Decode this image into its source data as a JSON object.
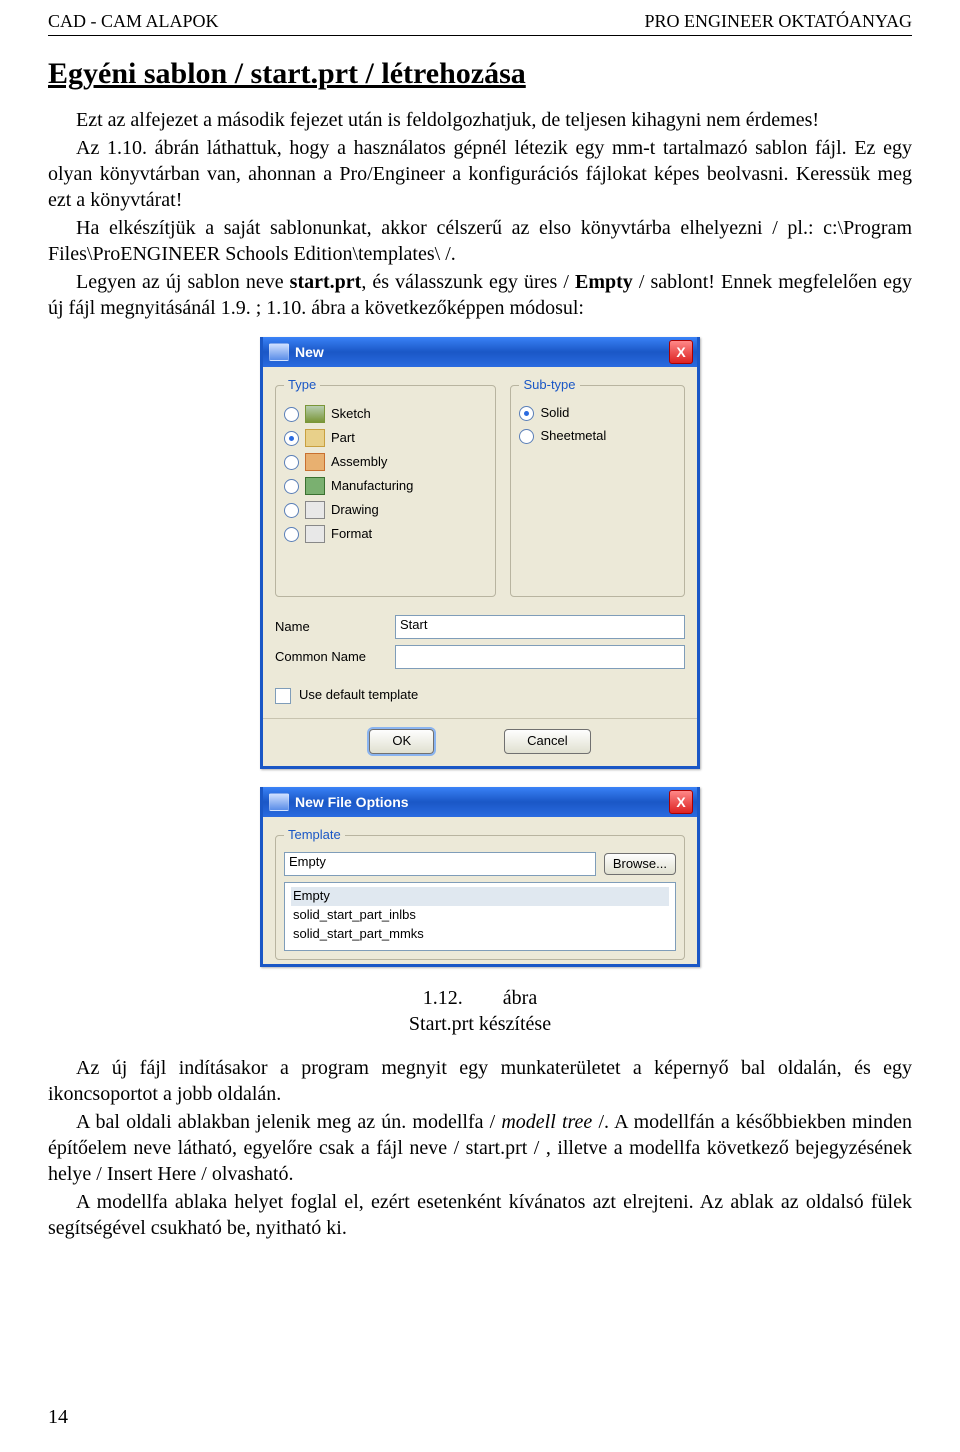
{
  "header": {
    "left": "CAD - CAM ALAPOK",
    "right": "PRO ENGINEER OKTATÓANYAG"
  },
  "section_title": "Egyéni sablon / start.prt / létrehozása",
  "paragraphs_top": [
    "Ezt az alfejezet a második fejezet után is feldolgozhatjuk, de teljesen kihagyni nem érdemes!",
    "Az 1.10. ábrán láthattuk, hogy a használatos gépnél létezik egy mm-t tartalmazó sablon fájl. Ez egy olyan könyvtárban van, ahonnan a Pro/Engineer a konfigurációs fájlokat képes beolvasni. Keressük meg ezt a könyvtárat!",
    "Ha elkészítjük a saját sablonunkat, akkor célszerű az elso könyvtárba elhelyezni / pl.: c:\\Program Files\\ProENGINEER Schools Edition\\templates\\  /.",
    "Legyen az új sablon neve start.prt, és válasszunk egy üres / Empty / sablont! Ennek megfelelően egy új fájl megnyitásánál 1.9. ; 1.10. ábra a következőképpen módosul:"
  ],
  "dlg_new": {
    "title": "New",
    "close_x": "X",
    "type_legend": "Type",
    "sub_legend": "Sub-type",
    "types": [
      {
        "label": "Sketch",
        "checked": false,
        "ic": "sk"
      },
      {
        "label": "Part",
        "checked": true,
        "ic": "pt"
      },
      {
        "label": "Assembly",
        "checked": false,
        "ic": "as"
      },
      {
        "label": "Manufacturing",
        "checked": false,
        "ic": "mf"
      },
      {
        "label": "Drawing",
        "checked": false,
        "ic": "dw"
      },
      {
        "label": "Format",
        "checked": false,
        "ic": "fm"
      }
    ],
    "subtypes": [
      {
        "label": "Solid",
        "checked": true
      },
      {
        "label": "Sheetmetal",
        "checked": false
      }
    ],
    "name_label": "Name",
    "name_value": "Start",
    "common_label": "Common Name",
    "chk_label": "Use default template",
    "ok": "OK",
    "cancel": "Cancel"
  },
  "dlg_opts": {
    "title": "New File Options",
    "close_x": "X",
    "tpl_legend": "Template",
    "tpl_value": "Empty",
    "browse": "Browse...",
    "list": [
      "Empty",
      "solid_start_part_inlbs",
      "solid_start_part_mmks"
    ]
  },
  "caption": {
    "num": "1.12.",
    "label": "ábra",
    "sub": "Start.prt készítése"
  },
  "paragraphs_bottom": [
    "Az új fájl indításakor a program megnyit egy munkaterületet a képernyő bal oldalán, és egy ikoncsoportot a jobb oldalán.",
    "A bal oldali ablakban jelenik meg az ún. modellfa / modell tree /. A modellfán a későbbiekben minden építőelem neve látható, egyelőre csak a fájl neve / start.prt / , illetve a modellfa következő bejegyzésének helye / Insert Here / olvasható.",
    "A modellfa ablaka helyet foglal el, ezért esetenként kívánatos azt elrejteni. Az ablak az oldalsó fülek segítségével csukható be, nyitható ki."
  ],
  "page_number": "14"
}
